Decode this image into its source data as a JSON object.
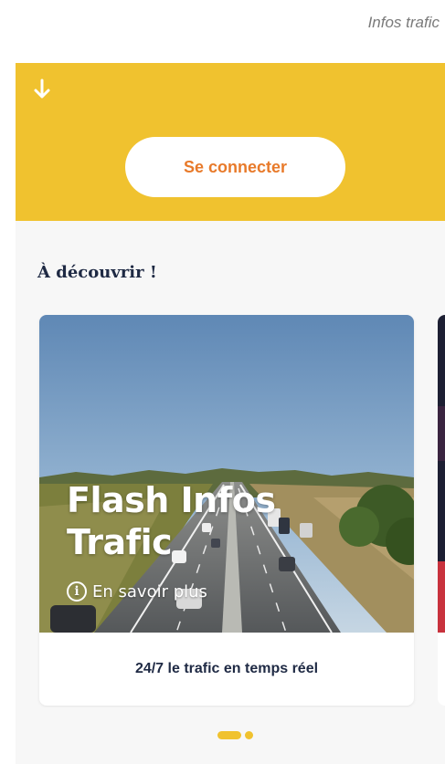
{
  "page_label": "Infos trafic",
  "header": {
    "back_icon": "arrow-down-icon",
    "connect_label": "Se connecter"
  },
  "section": {
    "title": "À découvrir !"
  },
  "carousel": {
    "cards": [
      {
        "headline": "Flash Infos Trafic",
        "more_label": "En savoir plus",
        "more_icon": "info-icon",
        "caption": "24/7 le trafic en temps réel"
      }
    ],
    "pager": {
      "count": 2,
      "active": 0
    }
  },
  "colors": {
    "header": "#f0c22f",
    "accent_text": "#e87a2a",
    "title_text": "#1f2a44",
    "background": "#f7f7f7"
  }
}
